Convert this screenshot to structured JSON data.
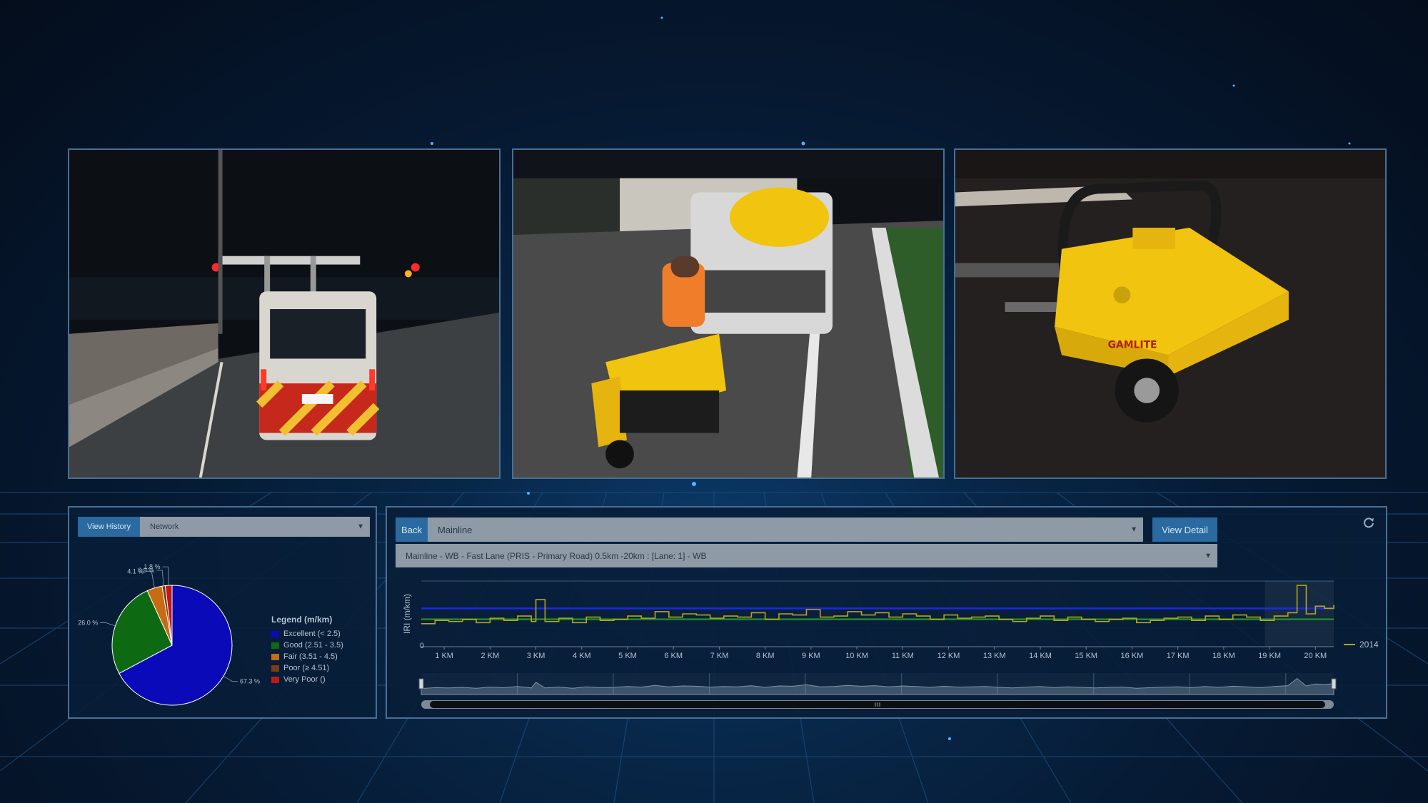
{
  "pie_panel": {
    "view_history_label": "View History",
    "network_select_value": "Network",
    "legend_title": "Legend (m/km)",
    "legend": [
      {
        "label": "Excellent (< 2.5)",
        "color": "#0a0ab8"
      },
      {
        "label": "Good (2.51 - 3.5)",
        "color": "#0e6a12"
      },
      {
        "label": "Fair (3.51 - 4.5)",
        "color": "#c76c12"
      },
      {
        "label": "Poor (≥ 4.51)",
        "color": "#7a3b12"
      },
      {
        "label": "Very Poor ()",
        "color": "#c01818"
      }
    ],
    "slices": [
      {
        "name": "Excellent",
        "value": 67.3,
        "color": "#0a0ab8",
        "label": "67.3 %"
      },
      {
        "name": "Good",
        "value": 26.0,
        "color": "#0e6a12",
        "label": "26.0 %"
      },
      {
        "name": "Fair",
        "value": 4.1,
        "color": "#c76c12",
        "label": "4.1 %"
      },
      {
        "name": "Poor",
        "value": 0.9,
        "color": "#7a3b12",
        "label": "0.9 %"
      },
      {
        "name": "Very Poor",
        "value": 1.8,
        "color": "#c01818",
        "label": "1.8 %"
      }
    ]
  },
  "chart_panel": {
    "back_label": "Back",
    "mainline_select_value": "Mainline",
    "view_detail_label": "View Detail",
    "section_select_value": "Mainline - WB - Fast Lane (PRIS - Primary Road) 0.5km -20km : [Lane: 1] - WB",
    "refresh_icon": "refresh-icon"
  },
  "chart_data": {
    "type": "line",
    "ylabel": "IRI (m/km)",
    "y_zero_label": "0",
    "x_tick_labels": [
      "1 KM",
      "2 KM",
      "3 KM",
      "4 KM",
      "5 KM",
      "6 KM",
      "7 KM",
      "8 KM",
      "9 KM",
      "10 KM",
      "11 KM",
      "12 KM",
      "13 KM",
      "14 KM",
      "15 KM",
      "16 KM",
      "17 KM",
      "18 KM",
      "19 KM",
      "20 KM"
    ],
    "xlim": [
      0.5,
      20.4
    ],
    "ylim": [
      0,
      6
    ],
    "threshold_lines": [
      {
        "y": 3.5,
        "color": "#1b2bd8"
      },
      {
        "y": 2.5,
        "color": "#1f8a2a"
      }
    ],
    "series": [
      {
        "name": "2014",
        "color": "#b8a51a",
        "x": [
          0.5,
          0.8,
          1.1,
          1.4,
          1.7,
          2.0,
          2.3,
          2.6,
          2.9,
          3.0,
          3.2,
          3.5,
          3.8,
          4.1,
          4.4,
          4.7,
          5.0,
          5.3,
          5.6,
          5.9,
          6.2,
          6.5,
          6.8,
          7.1,
          7.4,
          7.7,
          8.0,
          8.3,
          8.6,
          8.9,
          9.2,
          9.5,
          9.8,
          10.1,
          10.4,
          10.7,
          11.0,
          11.3,
          11.6,
          11.9,
          12.2,
          12.5,
          12.8,
          13.1,
          13.4,
          13.7,
          14.0,
          14.3,
          14.6,
          14.9,
          15.2,
          15.5,
          15.8,
          16.1,
          16.4,
          16.7,
          17.0,
          17.3,
          17.6,
          17.9,
          18.2,
          18.5,
          18.8,
          19.1,
          19.4,
          19.6,
          19.8,
          20.0,
          20.2,
          20.4
        ],
        "y": [
          2.1,
          2.4,
          2.3,
          2.5,
          2.2,
          2.6,
          2.4,
          2.8,
          2.3,
          4.3,
          2.3,
          2.6,
          2.2,
          2.7,
          2.4,
          2.5,
          2.8,
          2.6,
          3.2,
          2.7,
          3.0,
          2.9,
          2.6,
          2.8,
          2.7,
          3.1,
          2.5,
          3.0,
          2.9,
          3.4,
          2.7,
          2.8,
          3.2,
          2.9,
          3.1,
          2.7,
          3.0,
          2.8,
          2.5,
          2.9,
          2.6,
          2.7,
          2.8,
          2.5,
          2.3,
          2.6,
          2.8,
          2.4,
          2.7,
          2.5,
          2.3,
          2.5,
          2.6,
          2.2,
          2.4,
          2.6,
          2.7,
          2.4,
          2.8,
          2.5,
          2.9,
          2.7,
          2.4,
          2.8,
          3.1,
          5.6,
          3.0,
          3.7,
          3.5,
          3.8
        ]
      }
    ],
    "title": "",
    "xlabel": "",
    "grid": true,
    "legend_position": "right"
  }
}
